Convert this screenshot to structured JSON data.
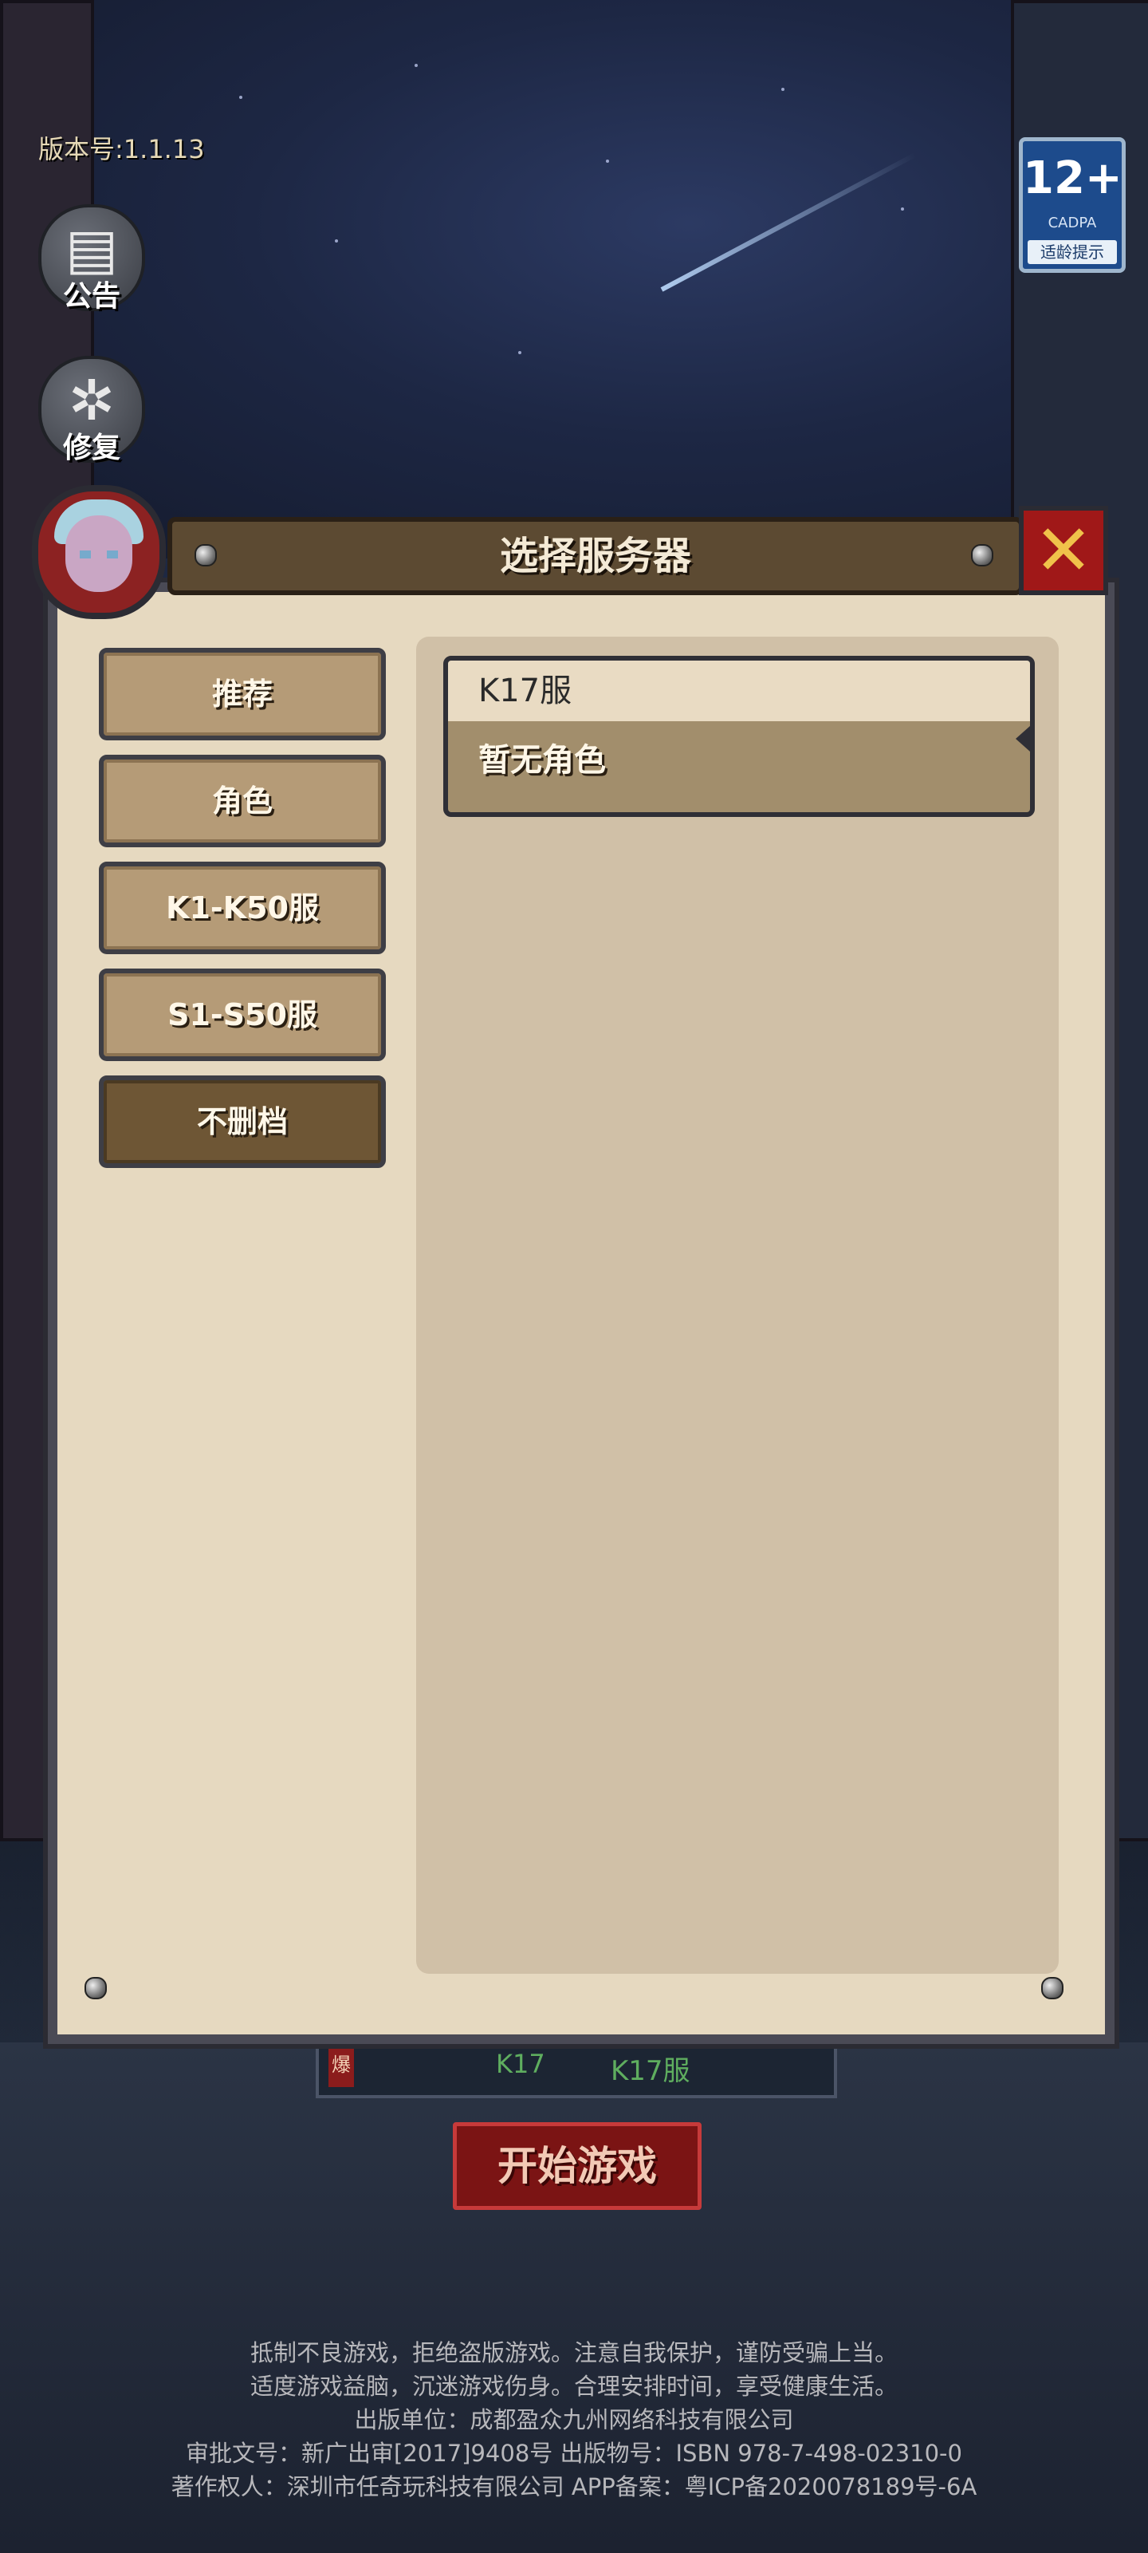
{
  "hud": {
    "version_label": "版本号:1.1.13",
    "notice_label": "公告",
    "repair_label": "修复"
  },
  "age_badge": {
    "rating": "12+",
    "org": "CADPA",
    "tip": "适龄提示"
  },
  "dialog": {
    "title": "选择服务器",
    "close_icon": "x-icon",
    "categories": [
      {
        "label": "推荐",
        "active": false
      },
      {
        "label": "角色",
        "active": false
      },
      {
        "label": "K1-K50服",
        "active": false
      },
      {
        "label": "S1-S50服",
        "active": false
      },
      {
        "label": "不删档",
        "active": true
      }
    ],
    "server": {
      "name": "K17服",
      "status": "暂无角色"
    }
  },
  "current_server": {
    "flag": "爆",
    "code": "K17",
    "name": "K17服"
  },
  "start_button": "开始游戏",
  "footer": {
    "line1": "抵制不良游戏，拒绝盗版游戏。注意自我保护，谨防受骗上当。",
    "line2": "适度游戏益脑，沉迷游戏伤身。合理安排时间，享受健康生活。",
    "line3": "出版单位：成都盈众九州网络科技有限公司",
    "line4": "审批文号：新广出审[2017]9408号 出版物号：ISBN 978-7-498-02310-0",
    "line5": "著作权人：深圳市任奇玩科技有限公司 APP备案：粤ICP备2020078189号-6A"
  },
  "colors": {
    "panel_bg": "#e6d9c0",
    "list_bg": "#d0c0a7",
    "header_bg": "#5c4a32",
    "button_bg": "#b59b77",
    "button_active_bg": "#6e5635",
    "close_bg": "#a01818",
    "start_bg": "#7b1414"
  }
}
